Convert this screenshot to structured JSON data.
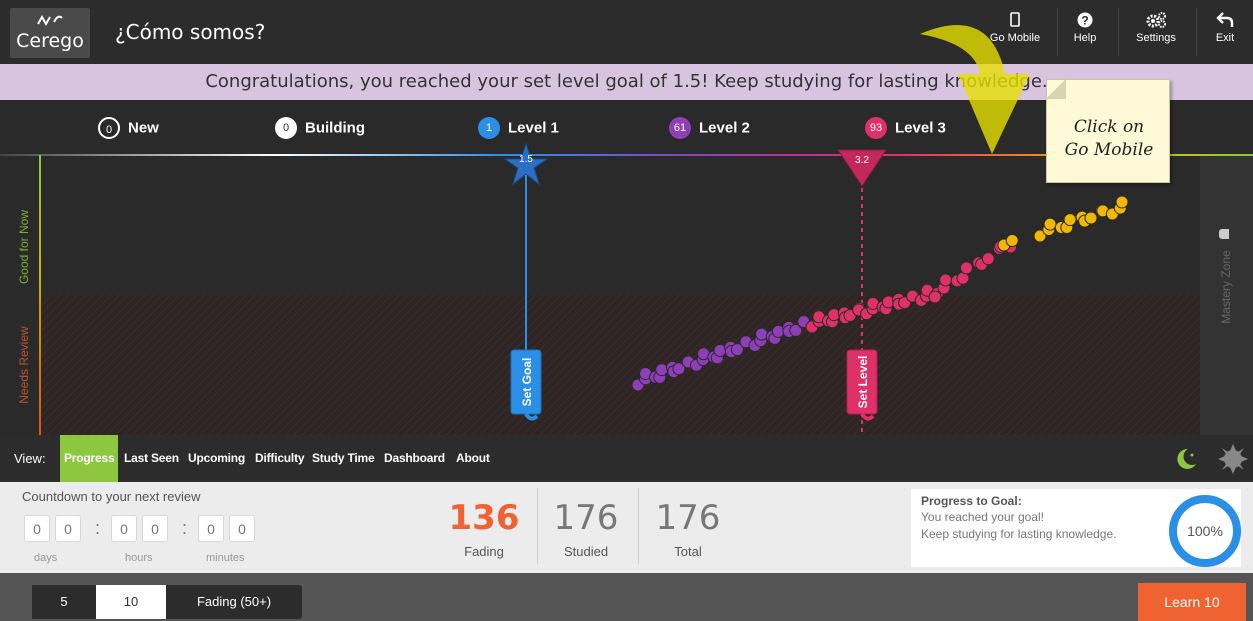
{
  "header": {
    "logo_text": "Cerego",
    "title": "¿Cómo somos?",
    "buttons": [
      {
        "label": "Go Mobile",
        "icon": "mobile-icon"
      },
      {
        "label": "Help",
        "icon": "help-icon"
      },
      {
        "label": "Settings",
        "icon": "gear-icon"
      },
      {
        "label": "Exit",
        "icon": "back-arrow-icon"
      }
    ]
  },
  "banner": {
    "text": "Congratulations, you reached your set level goal of 1.5! Keep studying for lasting knowledge."
  },
  "levels": [
    {
      "count": "0",
      "label": "New",
      "color": "#2a2a2a"
    },
    {
      "count": "0",
      "label": "Building",
      "color": "#ffffff"
    },
    {
      "count": "1",
      "label": "Level 1",
      "color": "#2b8fe6"
    },
    {
      "count": "61",
      "label": "Level 2",
      "color": "#8e3fb8"
    },
    {
      "count": "93",
      "label": "Level 3",
      "color": "#e0306a"
    }
  ],
  "chart": {
    "y_zone_top": "Good for Now",
    "y_zone_bottom": "Needs Review",
    "right_zone": "Mastery Zone",
    "goal_marker": "1.5",
    "goal_button": "Set Goal",
    "level_marker": "3.2",
    "level_button": "Set Level"
  },
  "view": {
    "label": "View:",
    "tabs": [
      "Progress",
      "Last Seen",
      "Upcoming",
      "Difficulty",
      "Study Time",
      "Dashboard",
      "About"
    ],
    "active": "Progress"
  },
  "countdown": {
    "title": "Countdown to your next review",
    "days": [
      "0",
      "0"
    ],
    "hours": [
      "0",
      "0"
    ],
    "minutes": [
      "0",
      "0"
    ],
    "labels": [
      "days",
      "hours",
      "minutes"
    ]
  },
  "stats": [
    {
      "value": "136",
      "label": "Fading",
      "color": "#ee6331"
    },
    {
      "value": "176",
      "label": "Studied",
      "color": "#777777"
    },
    {
      "value": "176",
      "label": "Total",
      "color": "#777777"
    }
  ],
  "goal": {
    "title": "Progress to Goal:",
    "line1": "You reached your goal!",
    "line2": "Keep studying for lasting knowledge.",
    "percent": "100%",
    "progress": 1.0
  },
  "footer": {
    "options": [
      "5",
      "10",
      "Fading (50+)"
    ],
    "selected": "10",
    "learn_button": "Learn 10"
  },
  "annotation": {
    "line1": "Click on",
    "line2": "Go Mobile"
  }
}
